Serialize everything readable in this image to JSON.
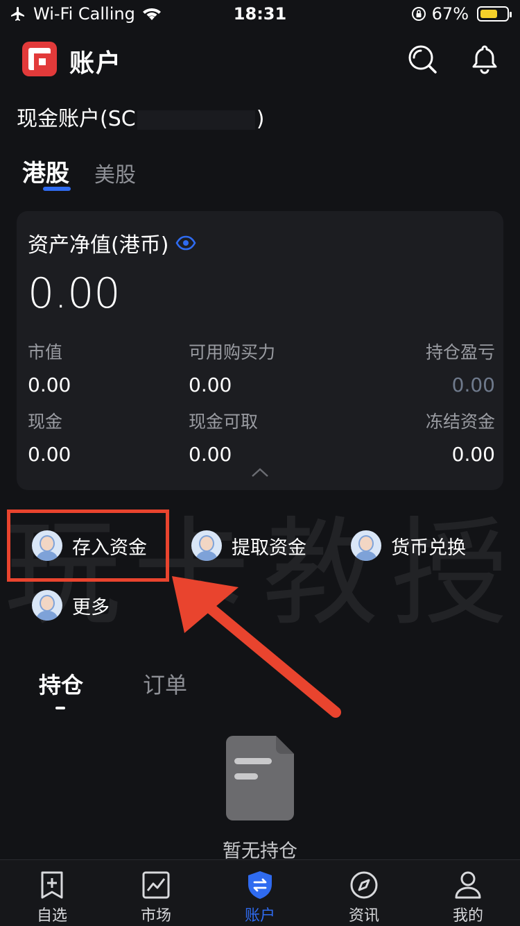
{
  "status_bar": {
    "carrier": "Wi-Fi Calling",
    "time": "18:31",
    "battery": "67%",
    "battery_level": 0.67
  },
  "header": {
    "title": "账户"
  },
  "account": {
    "prefix": "现金账户(SC",
    "suffix": ")"
  },
  "market_tabs": [
    "港股",
    "美股"
  ],
  "card": {
    "title": "资产净值(港币)",
    "net_value": "0.00",
    "stats": [
      {
        "label": "市值",
        "value": "0.00"
      },
      {
        "label": "可用购买力",
        "value": "0.00"
      },
      {
        "label": "持仓盈亏",
        "value": "0.00"
      },
      {
        "label": "现金",
        "value": "0.00"
      },
      {
        "label": "现金可取",
        "value": "0.00"
      },
      {
        "label": "冻结资金",
        "value": "0.00"
      }
    ]
  },
  "quick_actions": [
    "存入资金",
    "提取资金",
    "货币兑换",
    "更多"
  ],
  "watermark": "玩卡教授",
  "position_tabs": [
    "持仓",
    "订单"
  ],
  "empty_state": "暂无持仓",
  "bottom_nav": [
    "自选",
    "市场",
    "账户",
    "资讯",
    "我的"
  ],
  "colors": {
    "accent": "#2f6bf0",
    "highlight": "#e9442e",
    "background": "#121316"
  }
}
